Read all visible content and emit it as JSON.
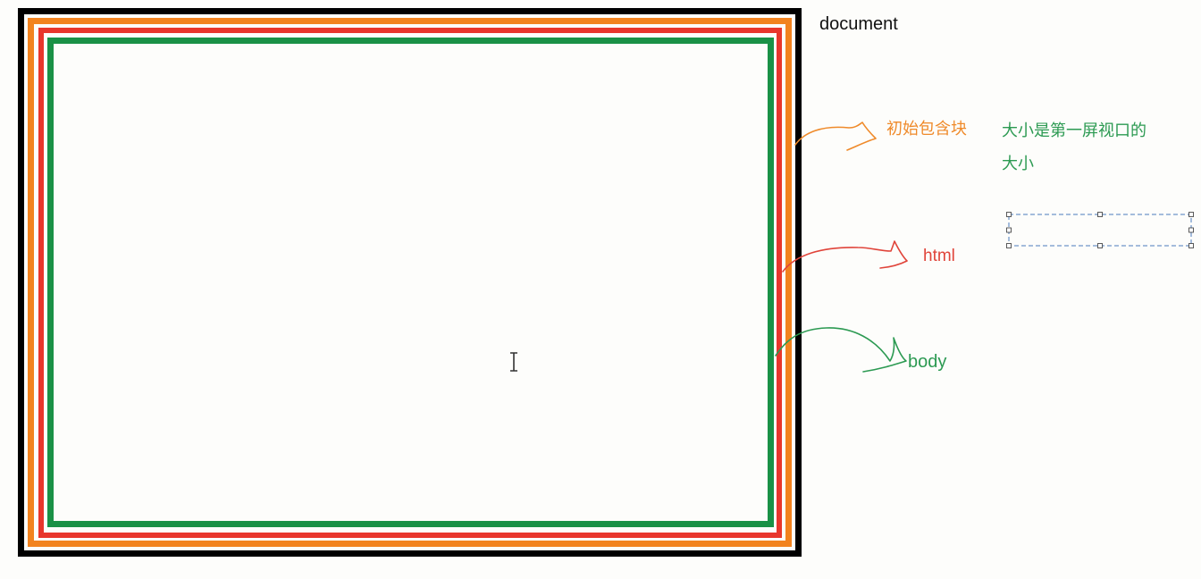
{
  "labels": {
    "document": "document",
    "initial_containing_block": "初始包含块",
    "size_note_line1": "大小是第一屏视口的",
    "size_note_line2": "大小",
    "html": "html",
    "body": "body"
  },
  "colors": {
    "document": "#000000",
    "initial_containing_block": "#f2831f",
    "html": "#e8362c",
    "body": "#1a9146",
    "note": "#2c9a52",
    "selection": "#4a7bbd"
  },
  "icons": {
    "cursor": "text-cursor-icon"
  }
}
